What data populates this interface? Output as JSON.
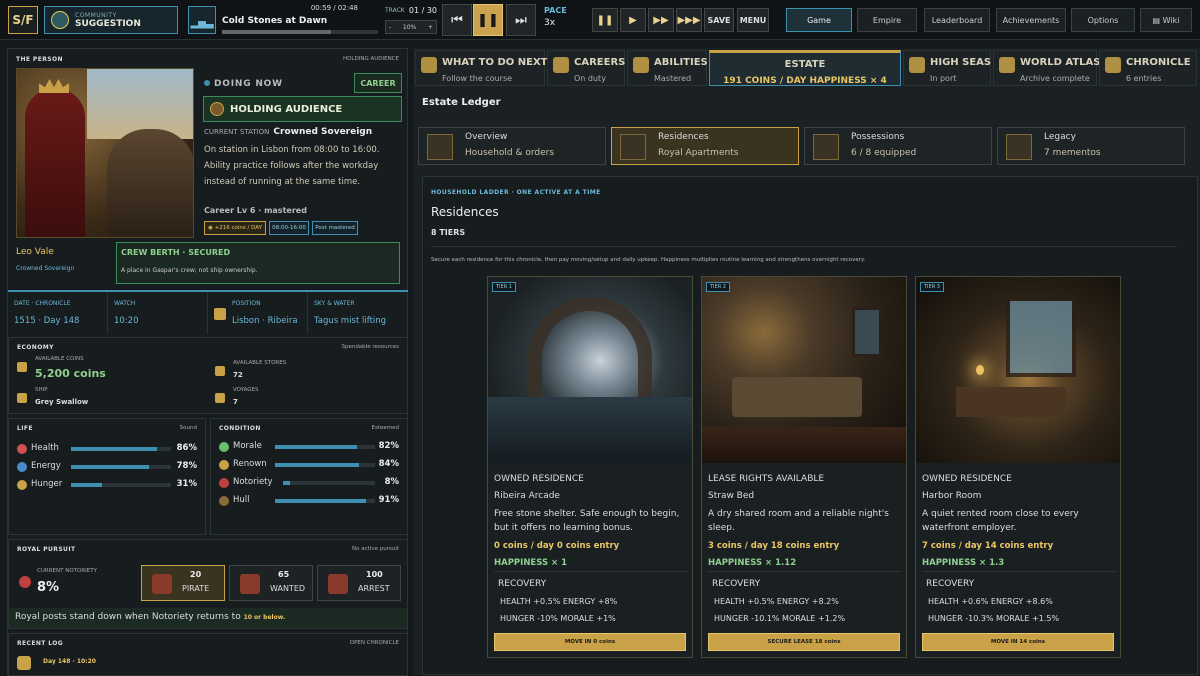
{
  "top": {
    "logo": "S/F",
    "community_label": "COMMUNITY",
    "community_value": "SUGGESTION",
    "song_time": "00:59 / 02:48",
    "song_title": "Cold Stones at Dawn",
    "track_label": "TRACK",
    "track_num": "01 / 30",
    "vol_minus": "-",
    "vol_value": "10%",
    "vol_plus": "+",
    "pace_label": "PACE",
    "pace_value": "3x",
    "save": "SAVE",
    "menu": "MENU",
    "nav": [
      "Game",
      "Empire",
      "Leaderboard",
      "Achievements",
      "Options",
      "Wiki"
    ]
  },
  "person": {
    "title": "THE PERSON",
    "status": "HOLDING AUDIENCE",
    "doing_now": "DOING NOW",
    "career_tag": "CAREER",
    "activity": "HOLDING AUDIENCE",
    "station_label": "CURRENT STATION",
    "station_value": "Crowned Sovereign",
    "description": "On station in Lisbon from 08:00 to 16:00. Ability practice follows after the workday instead of running at the same time.",
    "career_level": "Career Lv 6 · mastered",
    "chips": [
      "+216 coins / DAY",
      "08:00-16:00",
      "Post mastered"
    ],
    "name": "Leo Vale",
    "name_title": "Crowned Sovereign",
    "berth_title": "CREW BERTH · SECURED",
    "berth_desc": "A place in Gaspar's crew; not ship ownership.",
    "info": [
      {
        "k": "DATE · CHRONICLE",
        "v": "1515 · Day 148"
      },
      {
        "k": "WATCH",
        "v": "10:20"
      },
      {
        "k": "POSITION",
        "v": "Lisbon · Ribeira"
      },
      {
        "k": "SKY & WATER",
        "v": "Tagus mist lifting"
      }
    ]
  },
  "economy": {
    "title": "ECONOMY",
    "right": "Spendable resources",
    "coins_label": "AVAILABLE COINS",
    "coins": "5,200 coins",
    "stores_label": "AVAILABLE STORES",
    "stores": "72",
    "ship_label": "SHIP",
    "ship": "Grey Swallow",
    "voyages_label": "VOYAGES",
    "voyages": "7"
  },
  "life": {
    "title": "LIFE",
    "right": "Sound",
    "stats": [
      {
        "label": "Health",
        "pct": "86%",
        "value": 0.86
      },
      {
        "label": "Energy",
        "pct": "78%",
        "value": 0.78
      },
      {
        "label": "Hunger",
        "pct": "31%",
        "value": 0.31
      }
    ]
  },
  "condition": {
    "title": "CONDITION",
    "right": "Esteemed",
    "stats": [
      {
        "label": "Morale",
        "pct": "82%",
        "value": 0.82
      },
      {
        "label": "Renown",
        "pct": "84%",
        "value": 0.84
      },
      {
        "label": "Notoriety",
        "pct": "8%",
        "value": 0.08
      },
      {
        "label": "Hull",
        "pct": "91%",
        "value": 0.91
      }
    ]
  },
  "pursuit": {
    "title": "ROYAL PURSUIT",
    "right": "No active pursuit",
    "notoriety_label": "CURRENT NOTORIETY",
    "notoriety": "8%",
    "cards": [
      {
        "num": "20",
        "label": "PIRATE"
      },
      {
        "num": "65",
        "label": "WANTED"
      },
      {
        "num": "100",
        "label": "ARREST"
      }
    ],
    "note": "Royal posts stand down when Notoriety returns to",
    "note_em": "10 or below."
  },
  "log": {
    "title": "RECENT LOG",
    "right": "OPEN CHRONICLE",
    "entry": "Day 148 · 10:20"
  },
  "tabs": [
    {
      "title": "WHAT TO DO NEXT",
      "sub": "Follow the course"
    },
    {
      "title": "CAREERS",
      "sub": "On duty"
    },
    {
      "title": "ABILITIES",
      "sub": "Mastered"
    },
    {
      "title": "ESTATE",
      "sub": "191 COINS / DAY  HAPPINESS × 4"
    },
    {
      "title": "HIGH SEAS",
      "sub": "In port"
    },
    {
      "title": "WORLD ATLAS",
      "sub": "Archive complete"
    },
    {
      "title": "CHRONICLE",
      "sub": "6 entries"
    }
  ],
  "estate": {
    "ledger": "Estate Ledger",
    "subs": [
      {
        "title": "Overview",
        "sub": "Household & orders"
      },
      {
        "title": "Residences",
        "sub": "Royal Apartments"
      },
      {
        "title": "Possessions",
        "sub": "6 / 8 equipped"
      },
      {
        "title": "Legacy",
        "sub": "7 mementos"
      }
    ],
    "ladder_cap": "HOUSEHOLD LADDER · ONE ACTIVE AT A TIME",
    "ladder_title": "Residences",
    "tiers": "8 TIERS",
    "ladder_desc": "Secure each residence for this chronicle, then pay moving/setup and daily upkeep. Happiness multiplies routine learning and strengthens overnight recovery.",
    "cards": [
      {
        "tier": "TIER 1",
        "status": "OWNED RESIDENCE",
        "name": "Ribeira Arcade",
        "desc": "Free stone shelter. Safe enough to begin, but it offers no learning bonus.",
        "cost": "0 coins / day   0 coins entry",
        "hap": "HAPPINESS × 1",
        "recovery": "RECOVERY",
        "r1": "HEALTH +0.5%   ENERGY +8%",
        "r2": "HUNGER -10%   MORALE +1%",
        "btn": "MOVE IN 0 coins"
      },
      {
        "tier": "TIER 2",
        "status": "LEASE RIGHTS AVAILABLE",
        "name": "Straw Bed",
        "desc": "A dry shared room and a reliable night's sleep.",
        "cost": "3 coins / day   18 coins entry",
        "hap": "HAPPINESS × 1.12",
        "recovery": "RECOVERY",
        "r1": "HEALTH +0.5%   ENERGY +8.2%",
        "r2": "HUNGER -10.1%   MORALE +1.2%",
        "btn": "SECURE LEASE 18 coins"
      },
      {
        "tier": "TIER 3",
        "status": "OWNED RESIDENCE",
        "name": "Harbor Room",
        "desc": "A quiet rented room close to every waterfront employer.",
        "cost": "7 coins / day   14 coins entry",
        "hap": "HAPPINESS × 1.3",
        "recovery": "RECOVERY",
        "r1": "HEALTH +0.6%   ENERGY +8.6%",
        "r2": "HUNGER -10.3%   MORALE +1.5%",
        "btn": "MOVE IN 14 coins"
      }
    ]
  }
}
